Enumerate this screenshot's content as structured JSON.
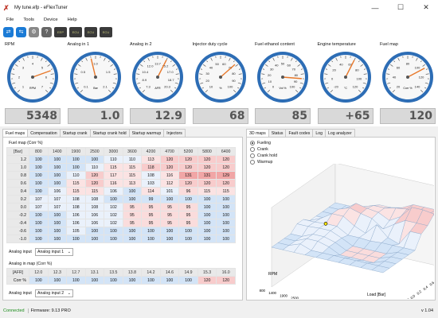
{
  "window": {
    "title": "My tune.efp - eFlexTuner",
    "icon": "app-logo-icon"
  },
  "menu": [
    "File",
    "Tools",
    "Device",
    "Help"
  ],
  "toolbar": {
    "buttons": [
      "connect-icon",
      "disconnect-icon",
      "settings-icon",
      "help-icon"
    ],
    "chips": [
      "EEP",
      "ECU",
      "ECU",
      "ECU"
    ]
  },
  "gauges": [
    {
      "title": "RPM",
      "unit": "RPM",
      "value": "5348",
      "ticks": [
        "1",
        "2",
        "3",
        "4",
        "5",
        "6",
        "7"
      ],
      "needle": 0.76
    },
    {
      "title": "Analog in 1",
      "unit": "Bar",
      "value": "1.0",
      "ticks": [
        "0.1",
        "0.5",
        "1.0",
        "1.5",
        "2.1"
      ],
      "needle": 0.45
    },
    {
      "title": "Analog in 2",
      "unit": "AFR",
      "value": "12.9",
      "ticks": [
        "7.3",
        "8.9",
        "10.4",
        "12.0",
        "13.7",
        "15.2",
        "17.0",
        "18.7",
        "20.3"
      ],
      "needle": 0.6
    },
    {
      "title": "Injector duty cycle",
      "unit": "%",
      "value": "68",
      "ticks": [
        "10",
        "20",
        "30",
        "40",
        "50",
        "60",
        "70",
        "80",
        "90",
        "100"
      ],
      "needle": 0.68
    },
    {
      "title": "Fuel ethanol content",
      "unit": "Vol %",
      "value": "85",
      "ticks": [
        "0",
        "10",
        "20",
        "30",
        "40",
        "50",
        "60",
        "70",
        "80",
        "90",
        "100"
      ],
      "needle": 0.85
    },
    {
      "title": "Engine temperature",
      "unit": "°C",
      "value": "+65",
      "ticks": [
        "-20",
        "0",
        "20",
        "40",
        "60",
        "80",
        "100",
        "120"
      ],
      "needle": 0.6
    },
    {
      "title": "Fuel map",
      "unit": "Corr %",
      "value": "120",
      "ticks": [
        "20",
        "40",
        "60",
        "80",
        "100",
        "120",
        "140"
      ],
      "needle": 0.73
    }
  ],
  "left_tabs": [
    "Fuel maps",
    "Compensation",
    "Startup crank",
    "Startup crank hold",
    "Startup warmup",
    "Injectors"
  ],
  "fuel_map": {
    "caption": "Fuel map (Corr %)",
    "corner": "[Bar]",
    "columns": [
      "800",
      "1400",
      "1900",
      "2500",
      "3000",
      "3600",
      "4200",
      "4700",
      "5200",
      "5800",
      "6400"
    ],
    "rows": [
      {
        "label": "1.2",
        "values": [
          "100",
          "100",
          "100",
          "100",
          "110",
          "110",
          "113",
          "120",
          "120",
          "120",
          "120"
        ]
      },
      {
        "label": "1.0",
        "values": [
          "100",
          "100",
          "100",
          "110",
          "115",
          "115",
          "118",
          "120",
          "120",
          "120",
          "120"
        ]
      },
      {
        "label": "0.8",
        "values": [
          "100",
          "100",
          "110",
          "120",
          "117",
          "115",
          "108",
          "116",
          "131",
          "131",
          "129"
        ]
      },
      {
        "label": "0.6",
        "values": [
          "100",
          "100",
          "115",
          "120",
          "116",
          "113",
          "103",
          "112",
          "120",
          "120",
          "120"
        ]
      },
      {
        "label": "0.4",
        "values": [
          "100",
          "106",
          "115",
          "115",
          "106",
          "100",
          "114",
          "101",
          "96",
          "115",
          "115"
        ]
      },
      {
        "label": "0.2",
        "values": [
          "107",
          "107",
          "108",
          "108",
          "100",
          "100",
          "99",
          "100",
          "100",
          "100",
          "100"
        ]
      },
      {
        "label": "0.0",
        "values": [
          "107",
          "107",
          "108",
          "108",
          "102",
          "95",
          "95",
          "95",
          "95",
          "100",
          "100"
        ]
      },
      {
        "label": "-0.2",
        "values": [
          "100",
          "100",
          "106",
          "106",
          "102",
          "95",
          "95",
          "95",
          "95",
          "100",
          "100"
        ]
      },
      {
        "label": "-0.4",
        "values": [
          "100",
          "100",
          "106",
          "106",
          "102",
          "95",
          "95",
          "95",
          "95",
          "100",
          "100"
        ]
      },
      {
        "label": "-0.6",
        "values": [
          "100",
          "100",
          "105",
          "100",
          "100",
          "100",
          "100",
          "100",
          "100",
          "100",
          "100"
        ]
      },
      {
        "label": "-1.0",
        "values": [
          "100",
          "100",
          "100",
          "100",
          "100",
          "100",
          "100",
          "100",
          "100",
          "100",
          "100"
        ]
      }
    ]
  },
  "analog_input_1": {
    "label": "Analog input",
    "value": "Analog input 1"
  },
  "ign_map": {
    "caption": "Analog in map (Corr %)",
    "corner": "[AFR]",
    "columns": [
      "12.0",
      "12.3",
      "12.7",
      "13.1",
      "13.5",
      "13.8",
      "14.2",
      "14.6",
      "14.9",
      "15.3",
      "16.0"
    ],
    "rows": [
      {
        "label": "Corr %",
        "values": [
          "100",
          "100",
          "100",
          "100",
          "100",
          "100",
          "100",
          "100",
          "100",
          "120",
          "120"
        ]
      }
    ]
  },
  "analog_input_2": {
    "label": "Analog input",
    "value": "Analog input 2"
  },
  "right_tabs": [
    "3D maps",
    "Status",
    "Fault codes",
    "Log",
    "Log analyzer"
  ],
  "radio_options": [
    "Fueling",
    "Crank",
    "Crank hold",
    "Warmup"
  ],
  "plot": {
    "rpm_ticks": [
      "800",
      "1400",
      "1900",
      "2500",
      "3000",
      "3600",
      "4200",
      "4700",
      "5200",
      "5800",
      "6400"
    ],
    "rpm_label": "RPM",
    "load_ticks": [
      "-1.0",
      "-0.6",
      "-0.4",
      "-0.2",
      "0.0",
      "0.2",
      "0.4",
      "0.6",
      "0.8",
      "1.0",
      "1.2"
    ],
    "load_label": "Load [Bar]"
  },
  "status": {
    "connection": "Connected",
    "firmware": "Firmware: 9.13 PRO",
    "version": "v 1.04"
  },
  "colors": {
    "accent": "#1b7bd6",
    "connected": "#1a8c1a",
    "high": "#f4b3b3",
    "low": "#c9ddf4"
  }
}
